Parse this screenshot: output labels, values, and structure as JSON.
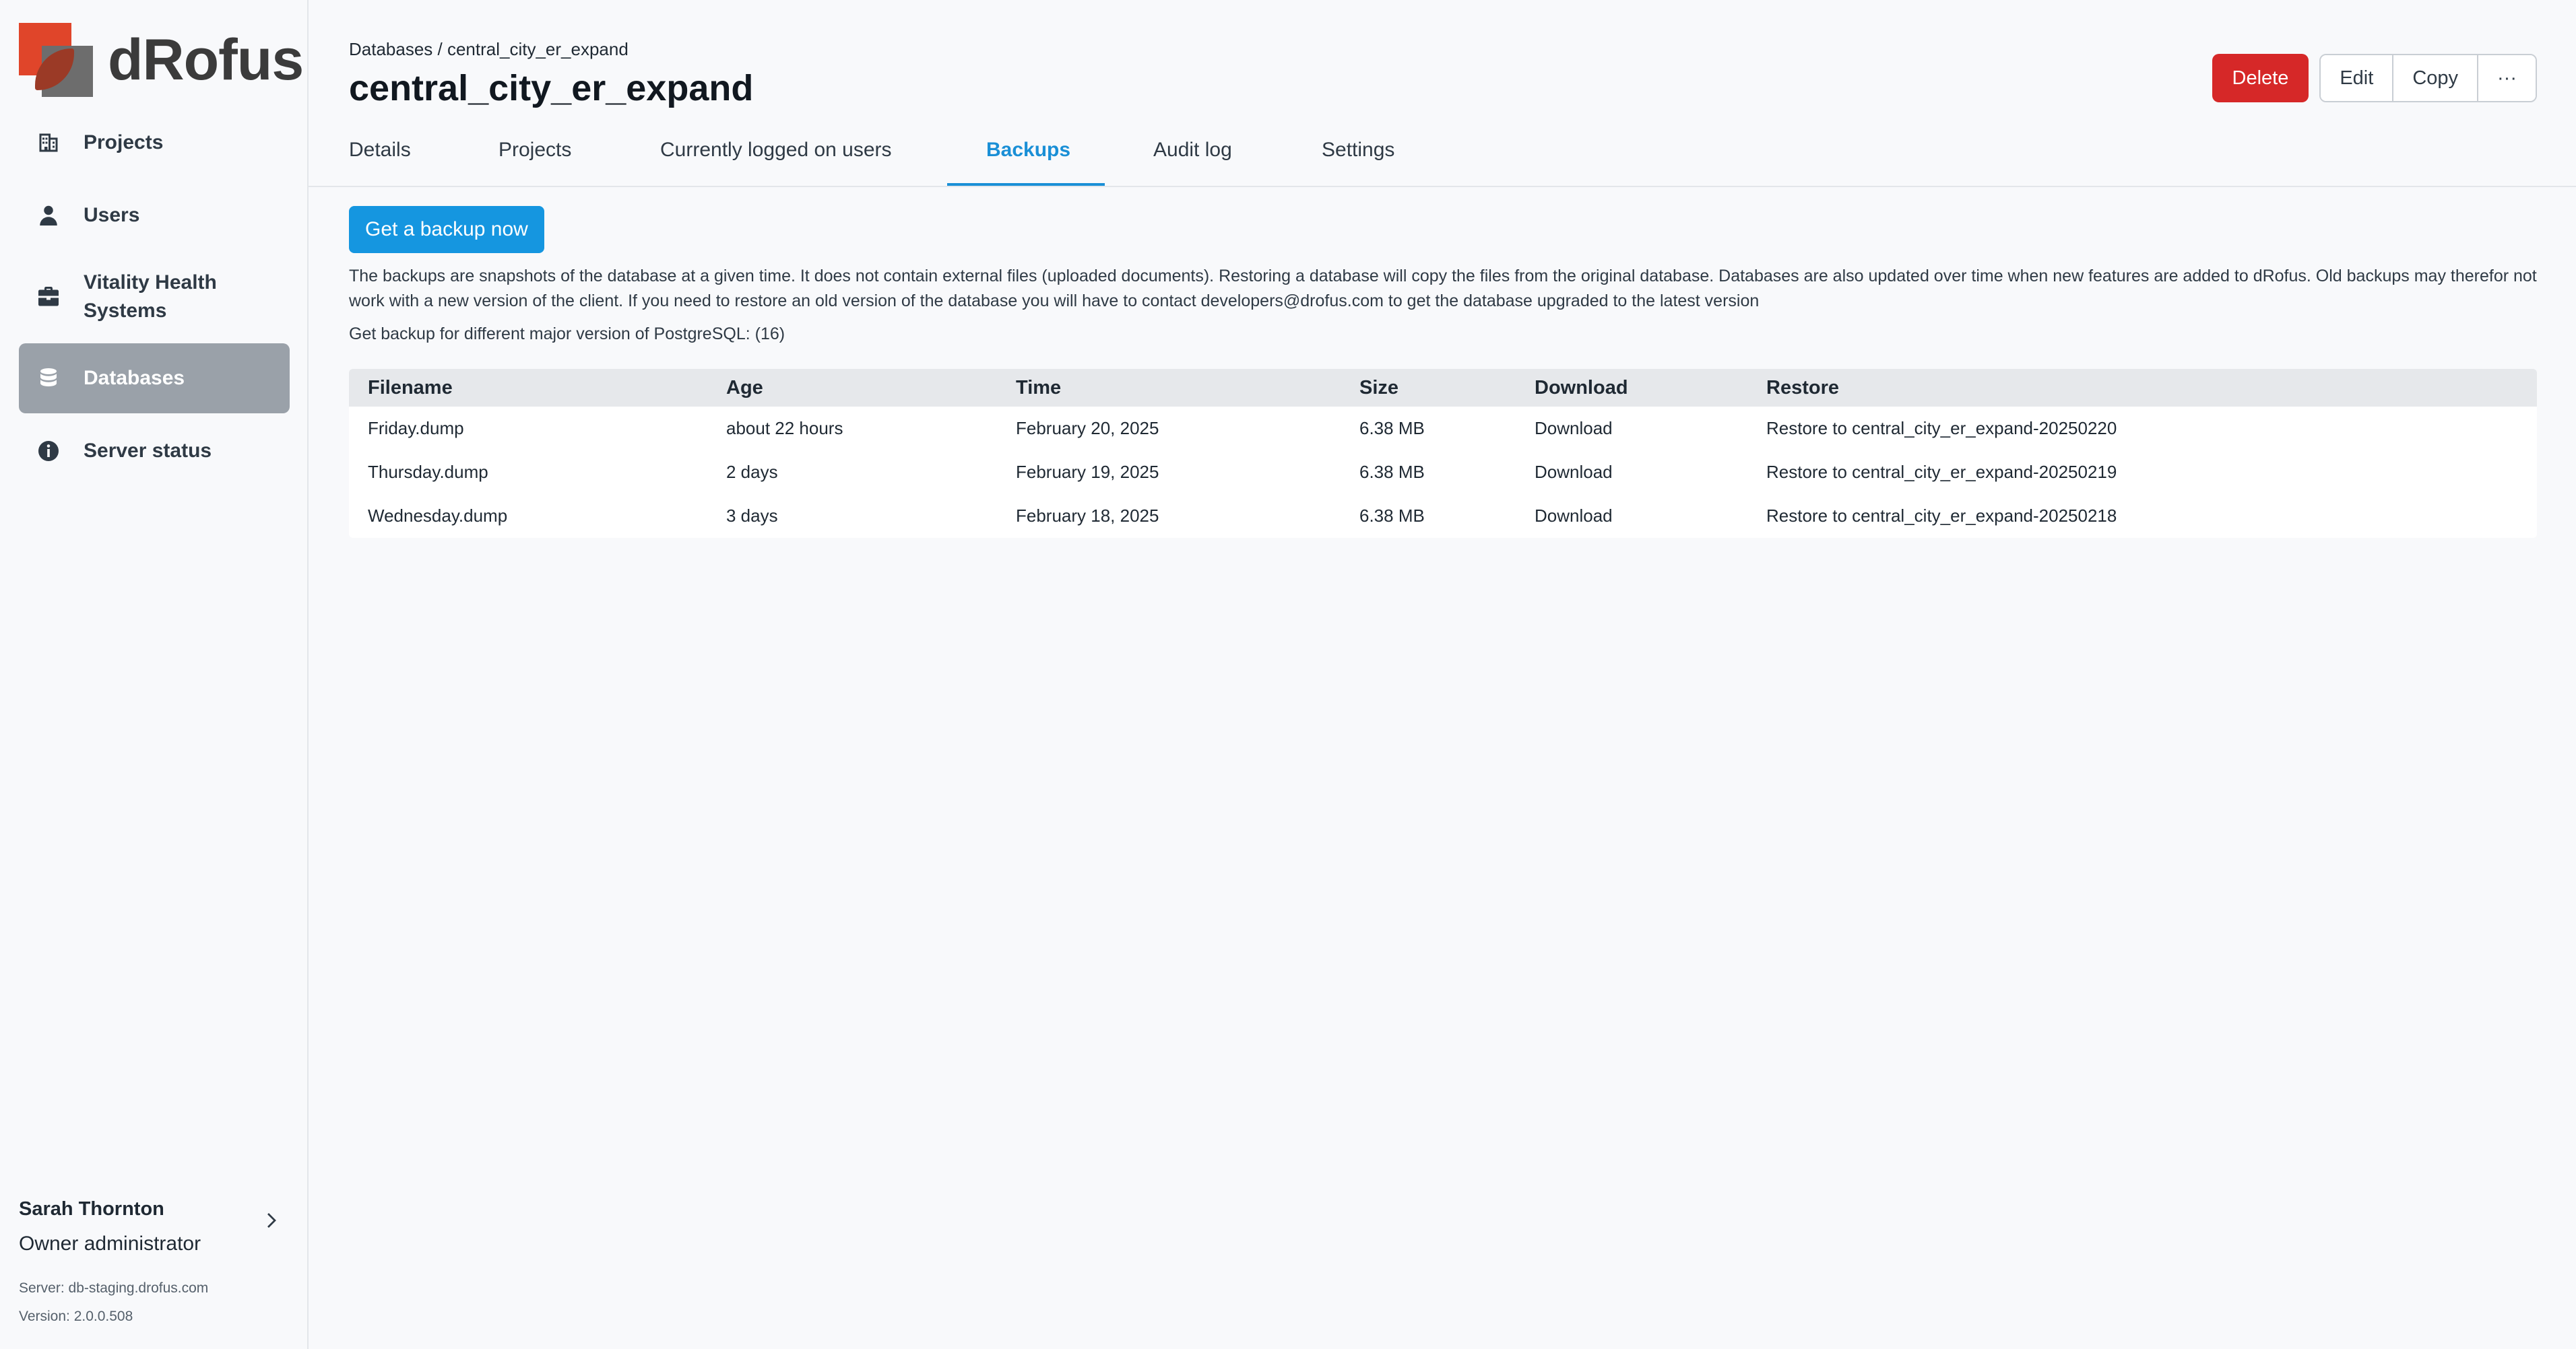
{
  "app": {
    "logo_text": "dRofus"
  },
  "sidebar": {
    "items": [
      {
        "label": "Projects",
        "icon": "building-icon"
      },
      {
        "label": "Users",
        "icon": "user-icon"
      },
      {
        "label": "Vitality Health Systems",
        "icon": "briefcase-icon"
      },
      {
        "label": "Databases",
        "icon": "database-icon",
        "active": true
      },
      {
        "label": "Server status",
        "icon": "info-icon"
      }
    ],
    "user": {
      "name": "Sarah Thornton",
      "role": "Owner administrator"
    },
    "server": "Server: db-staging.drofus.com",
    "version": "Version: 2.0.0.508"
  },
  "header": {
    "breadcrumb": "Databases / central_city_er_expand",
    "title": "central_city_er_expand",
    "actions": {
      "delete": "Delete",
      "edit": "Edit",
      "copy": "Copy",
      "more": "···"
    }
  },
  "tabs": [
    {
      "label": "Details"
    },
    {
      "label": "Projects"
    },
    {
      "label": "Currently logged on users"
    },
    {
      "label": "Backups",
      "active": true
    },
    {
      "label": "Audit log"
    },
    {
      "label": "Settings"
    }
  ],
  "backups": {
    "button": "Get a backup now",
    "info": "The backups are snapshots of the database at a given time. It does not contain external files (uploaded documents). Restoring a database will copy the files from the original database. Databases are also updated over time when new features are added to dRofus. Old backups may therefor not work with a new version of the client. If you need to restore an old version of the database you will have to contact developers@drofus.com to get the database upgraded to the latest version",
    "postgres_line": "Get backup for different major version of PostgreSQL: (16)",
    "columns": [
      "Filename",
      "Age",
      "Time",
      "Size",
      "Download",
      "Restore"
    ],
    "rows": [
      {
        "filename": "Friday.dump",
        "age": "about 22 hours",
        "time": "February 20, 2025",
        "size": "6.38 MB",
        "download": "Download",
        "restore": "Restore to central_city_er_expand-20250220"
      },
      {
        "filename": "Thursday.dump",
        "age": "2 days",
        "time": "February 19, 2025",
        "size": "6.38 MB",
        "download": "Download",
        "restore": "Restore to central_city_er_expand-20250219"
      },
      {
        "filename": "Wednesday.dump",
        "age": "3 days",
        "time": "February 18, 2025",
        "size": "6.38 MB",
        "download": "Download",
        "restore": "Restore to central_city_er_expand-20250218"
      }
    ]
  },
  "colors": {
    "accent": "#1596e0",
    "danger": "#d62828",
    "active_nav": "#9aa1a9"
  }
}
